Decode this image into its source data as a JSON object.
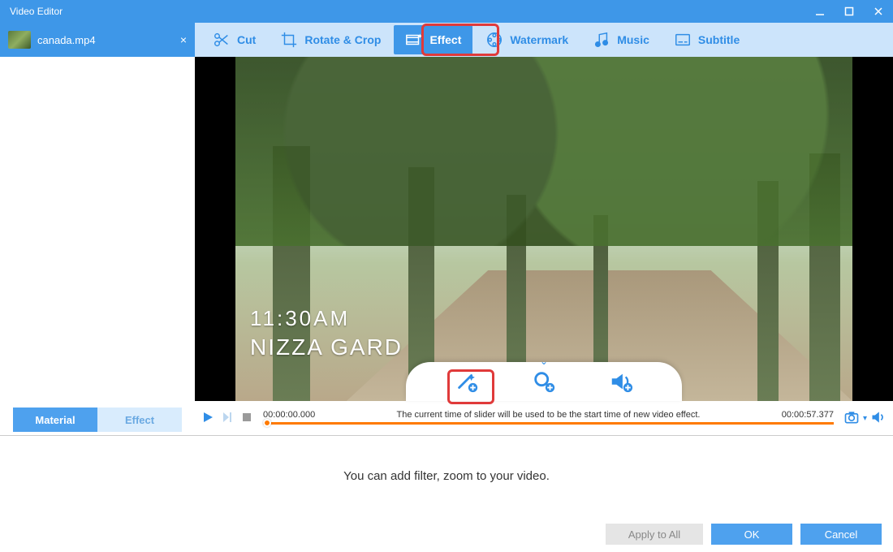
{
  "window": {
    "title": "Video Editor"
  },
  "file": {
    "name": "canada.mp4"
  },
  "tabs": {
    "cut": "Cut",
    "rotate": "Rotate & Crop",
    "effect": "Effect",
    "watermark": "Watermark",
    "music": "Music",
    "subtitle": "Subtitle"
  },
  "side_tabs": {
    "material": "Material",
    "effect": "Effect"
  },
  "overlay": {
    "time": "11:30AM",
    "place": "NIZZA GARD"
  },
  "timeline": {
    "start": "00:00:00.000",
    "end": "00:00:57.377",
    "hint": "The current time of slider will be used to be the start time of new video effect."
  },
  "footer": {
    "message": "You can add filter, zoom to your video.",
    "apply_all": "Apply to All",
    "ok": "OK",
    "cancel": "Cancel"
  }
}
